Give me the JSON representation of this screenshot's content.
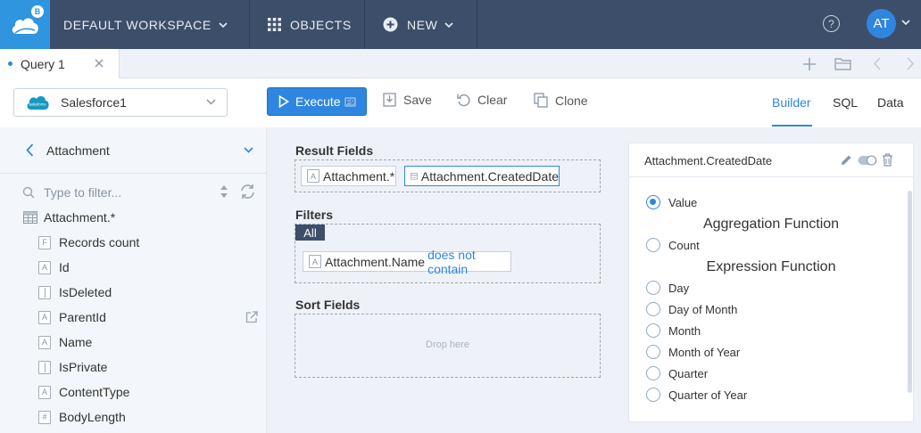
{
  "topbar": {
    "workspace_label": "DEFAULT WORKSPACE",
    "objects_label": "OBJECTS",
    "new_label": "NEW",
    "help_glyph": "?",
    "avatar_initials": "AT",
    "logo_badge": "B"
  },
  "tabs": [
    {
      "label": "Query 1"
    }
  ],
  "toolbar": {
    "connection": "Salesforce1",
    "connection_logo_text": "salesforce",
    "execute_label": "Execute",
    "execute_shortcut": "F9",
    "save_label": "Save",
    "clear_label": "Clear",
    "clone_label": "Clone",
    "view_tabs": [
      "Builder",
      "SQL",
      "Data"
    ],
    "active_view": "Builder"
  },
  "left_panel": {
    "object": "Attachment",
    "filter_placeholder": "Type to filter...",
    "tree": [
      {
        "label": "Attachment.*",
        "icon": "table-icon"
      },
      {
        "label": "Records count",
        "icon": "function-icon",
        "glyph": "F"
      },
      {
        "label": "Id",
        "icon": "text-type-icon",
        "glyph": "A"
      },
      {
        "label": "IsDeleted",
        "icon": "boolean-type-icon"
      },
      {
        "label": "ParentId",
        "icon": "text-type-icon",
        "glyph": "A"
      },
      {
        "label": "Name",
        "icon": "text-type-icon",
        "glyph": "A"
      },
      {
        "label": "IsPrivate",
        "icon": "boolean-type-icon"
      },
      {
        "label": "ContentType",
        "icon": "text-type-icon",
        "glyph": "A"
      },
      {
        "label": "BodyLength",
        "icon": "number-type-icon",
        "glyph": "#"
      }
    ]
  },
  "builder": {
    "result_fields_title": "Result Fields",
    "result_fields": [
      {
        "label": "Attachment.*",
        "icon": "text-type-icon",
        "glyph": "A"
      },
      {
        "label": "Attachment.CreatedDate",
        "icon": "calendar-icon"
      }
    ],
    "filters_title": "Filters",
    "filter_group": "All",
    "filter": {
      "field": "Attachment.Name",
      "operator": "does not contain",
      "glyph": "A"
    },
    "sort_fields_title": "Sort Fields",
    "drop_placeholder": "Drop here"
  },
  "properties": {
    "title": "Attachment.CreatedDate",
    "options": [
      {
        "label": "Value",
        "checked": true
      },
      {
        "label": "Count",
        "checked": false
      },
      {
        "label": "Day",
        "checked": false
      },
      {
        "label": "Day of Month",
        "checked": false
      },
      {
        "label": "Month",
        "checked": false
      },
      {
        "label": "Month of Year",
        "checked": false
      },
      {
        "label": "Quarter",
        "checked": false
      },
      {
        "label": "Quarter of Year",
        "checked": false
      }
    ],
    "aggregation_heading": "Aggregation Function",
    "expression_heading": "Expression Function"
  },
  "colors": {
    "nav": "#3d4e6b",
    "accent": "#2f86e0",
    "logo": "#2f95de",
    "panel": "#eef2f8"
  }
}
